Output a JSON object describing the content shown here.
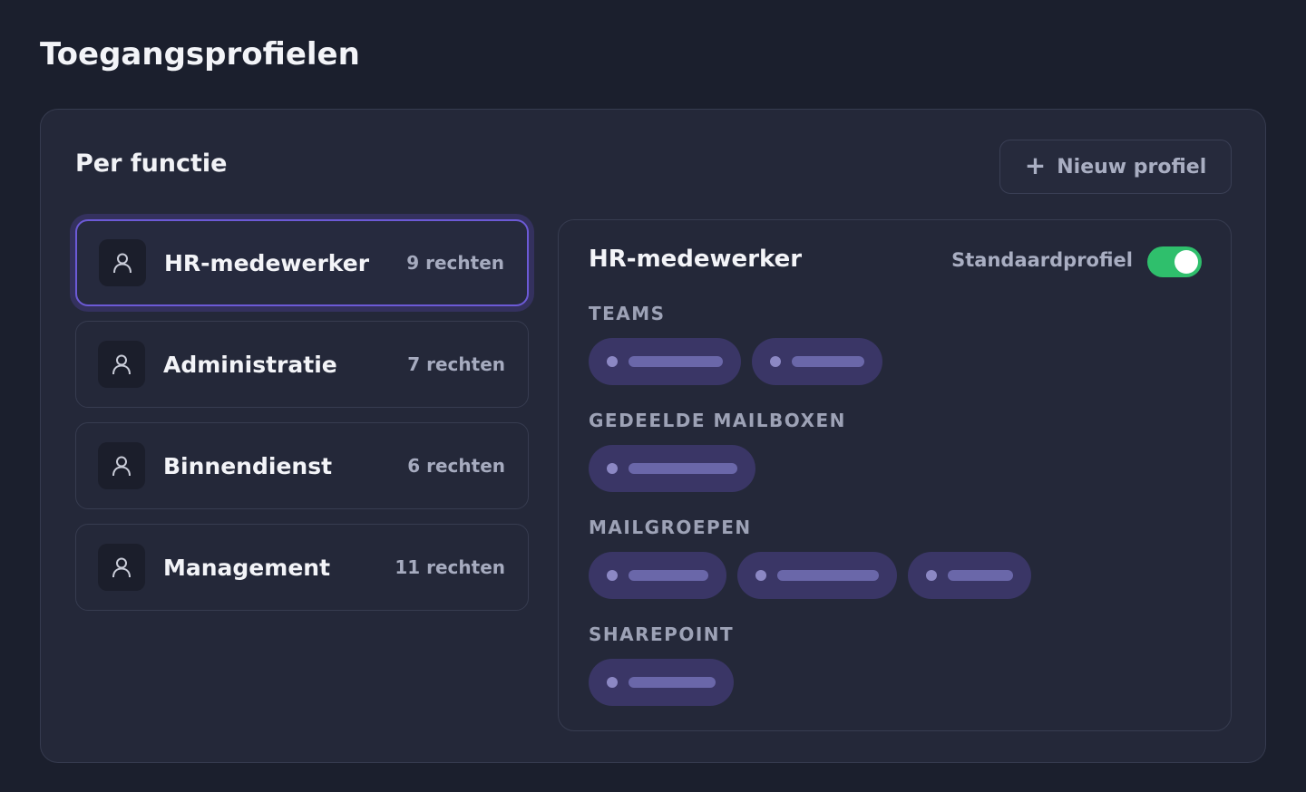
{
  "page": {
    "title": "Toegangsprofielen"
  },
  "card": {
    "section_title": "Per functie",
    "new_profile_button": {
      "icon": "plus-icon",
      "label": "Nieuw profiel"
    }
  },
  "profiles": [
    {
      "name": "HR-medewerker",
      "count": "9 rechten",
      "icon": "user-icon",
      "active": true
    },
    {
      "name": "Administratie",
      "count": "7 rechten",
      "icon": "user-icon",
      "active": false
    },
    {
      "name": "Binnendienst",
      "count": "6 rechten",
      "icon": "user-icon",
      "active": false
    },
    {
      "name": "Management",
      "count": "11 rechten",
      "icon": "user-icon",
      "active": false
    }
  ],
  "detail": {
    "title": "HR-medewerker",
    "standard_profile_label": "Standaardprofiel",
    "standard_profile_on": true,
    "groups": [
      {
        "label": "TEAMS",
        "chips": 2
      },
      {
        "label": "GEDEELDE MAILBOXEN",
        "chips": 1
      },
      {
        "label": "MAILGROEPEN",
        "chips": 3
      },
      {
        "label": "SHAREPOINT",
        "chips": 1
      }
    ]
  },
  "colors": {
    "background": "#1b1f2d",
    "card": "#242839",
    "accent": "#6c5ad6",
    "toggle_on": "#2fbf6c",
    "chip": "#3a3666"
  }
}
